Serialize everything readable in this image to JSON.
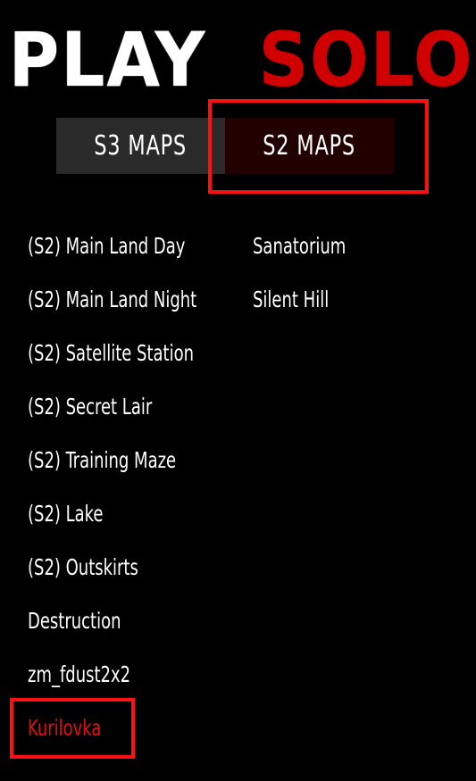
{
  "title": {
    "play": "PLAY",
    "solo": "SOLO"
  },
  "tabs": [
    {
      "label": "S3 MAPS",
      "selected": false
    },
    {
      "label": "S2 MAPS",
      "selected": true
    }
  ],
  "maps": {
    "column1": [
      "(S2) Main Land Day",
      "(S2) Main Land Night",
      "(S2) Satellite Station",
      "(S2) Secret Lair",
      "(S2) Training Maze",
      "(S2) Lake",
      "(S2) Outskirts",
      "Destruction",
      "zm_fdust2x2",
      "Kurilovka"
    ],
    "column2": [
      "Sanatorium",
      "Silent Hill"
    ],
    "selected": "Kurilovka"
  },
  "colors": {
    "background": "#000000",
    "accent_red": "#d00000",
    "highlight_border": "#ff1010",
    "tab_inactive": "#2a2a2a",
    "tab_active": "#220000"
  }
}
